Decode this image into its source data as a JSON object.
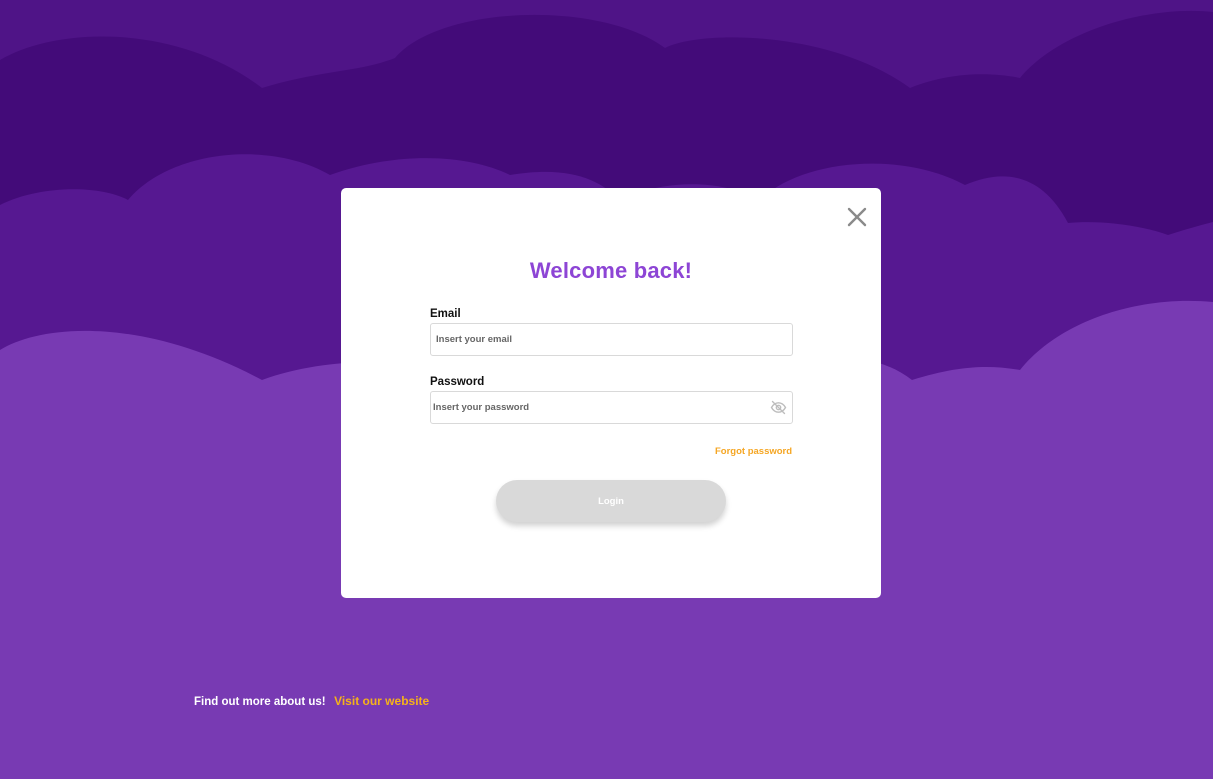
{
  "modal": {
    "title": "Welcome back!",
    "email": {
      "label": "Email",
      "placeholder": "Insert your email",
      "value": ""
    },
    "password": {
      "label": "Password",
      "placeholder": "Insert your password",
      "value": ""
    },
    "forgot_label": "Forgot password",
    "login_label": "Login",
    "close_icon": "close-icon",
    "visibility_icon": "eye-off-icon"
  },
  "footer": {
    "lead_text": "Find out more about us!",
    "link_text": "Visit our website"
  },
  "colors": {
    "background_dark": "#430b79",
    "background_mid": "#561891",
    "background_light": "#783ab3",
    "accent_purple": "#8d45d5",
    "accent_orange": "#f5a623",
    "button_disabled": "#d9d9d9"
  }
}
